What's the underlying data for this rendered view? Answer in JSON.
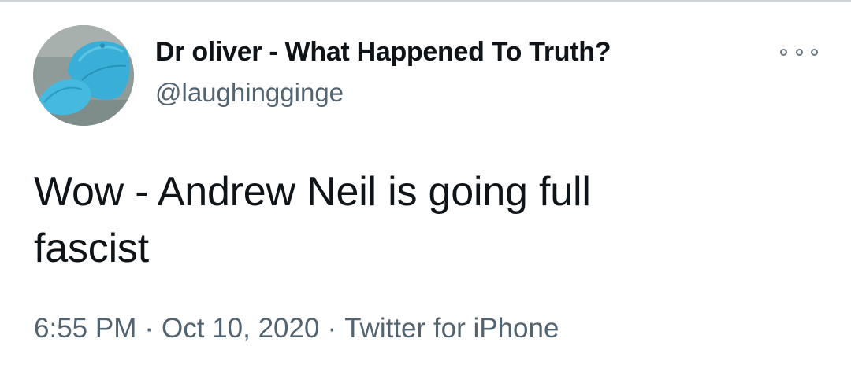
{
  "tweet": {
    "author": {
      "display_name": "Dr oliver - What Happened To Truth?",
      "handle": "@laughingginge",
      "avatar_icon": "blue-cap-avatar"
    },
    "more_icon": "more-options-icon",
    "text_line1": "Wow - Andrew Neil is going full",
    "text_line2": "fascist",
    "time": "6:55 PM",
    "separator": "·",
    "date": "Oct 10, 2020",
    "source": "Twitter for iPhone"
  },
  "colors": {
    "text_primary": "#0f1419",
    "text_secondary": "#536471",
    "background": "#ffffff",
    "avatar_cap": "#3bb0d6"
  }
}
